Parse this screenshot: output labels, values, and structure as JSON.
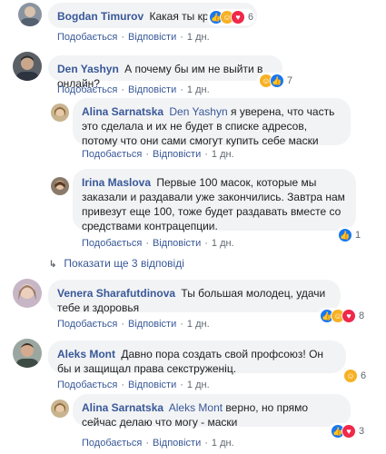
{
  "comments": [
    {
      "author": "Bogdan Timurov",
      "mention": "",
      "text": "Какая ты крутая",
      "like": "Подобається",
      "reply": "Відповісти",
      "time": "1 дн.",
      "reactions": [
        "like",
        "haha",
        "love"
      ],
      "count": "6"
    },
    {
      "author": "Den Yashyn",
      "mention": "",
      "text": "А почему бы им не выйти в онлайн?",
      "like": "Подобається",
      "reply": "Відповісти",
      "time": "1 дн.",
      "reactions": [
        "haha",
        "like"
      ],
      "count": "7"
    },
    {
      "author": "Alina Sarnatska",
      "mention": "Den Yashyn",
      "text": "я уверена, что часть это сделала и их не будет в списке адресов, потому что они сами смогут купить себе маски",
      "like": "Подобається",
      "reply": "Відповісти",
      "time": "1 дн."
    },
    {
      "author": "Irina Maslova",
      "mention": "",
      "text": "Первые 100 масок, которые мы заказали и раздавали уже закончились. Завтра нам привезут еще 100, тоже будет раздавать вместе со средствами контрацепции.",
      "like": "Подобається",
      "reply": "Відповісти",
      "time": "1 дн.",
      "reactions": [
        "like"
      ],
      "count": "1"
    },
    {
      "author": "Venera Sharafutdinova",
      "mention": "",
      "text": "Ты большая молодец, удачи тебе и здоровья",
      "like": "Подобається",
      "reply": "Відповісти",
      "time": "1 дн.",
      "reactions": [
        "like",
        "haha",
        "love"
      ],
      "count": "8"
    },
    {
      "author": "Aleks Mont",
      "mention": "",
      "text": "Давно пора создать свой профсоюз! Он бы и защищал права секструженіц.",
      "like": "Подобається",
      "reply": "Відповісти",
      "time": "1 дн.",
      "reactions": [
        "haha"
      ],
      "count": "6"
    },
    {
      "author": "Alina Sarnatska",
      "mention": "Aleks Mont",
      "text": "верно, но прямо сейчас делаю что могу - маски",
      "like": "Подобається",
      "reply": "Відповісти",
      "time": "1 дн.",
      "reactions": [
        "like",
        "love"
      ],
      "count": "3"
    }
  ],
  "show_more": "Показати ще 3 відповіді",
  "colors": {
    "link": "#385898",
    "bubble": "#f2f3f5",
    "meta": "#606770",
    "like": "#1877f2",
    "haha": "#f7b125",
    "love": "#f0284a"
  }
}
